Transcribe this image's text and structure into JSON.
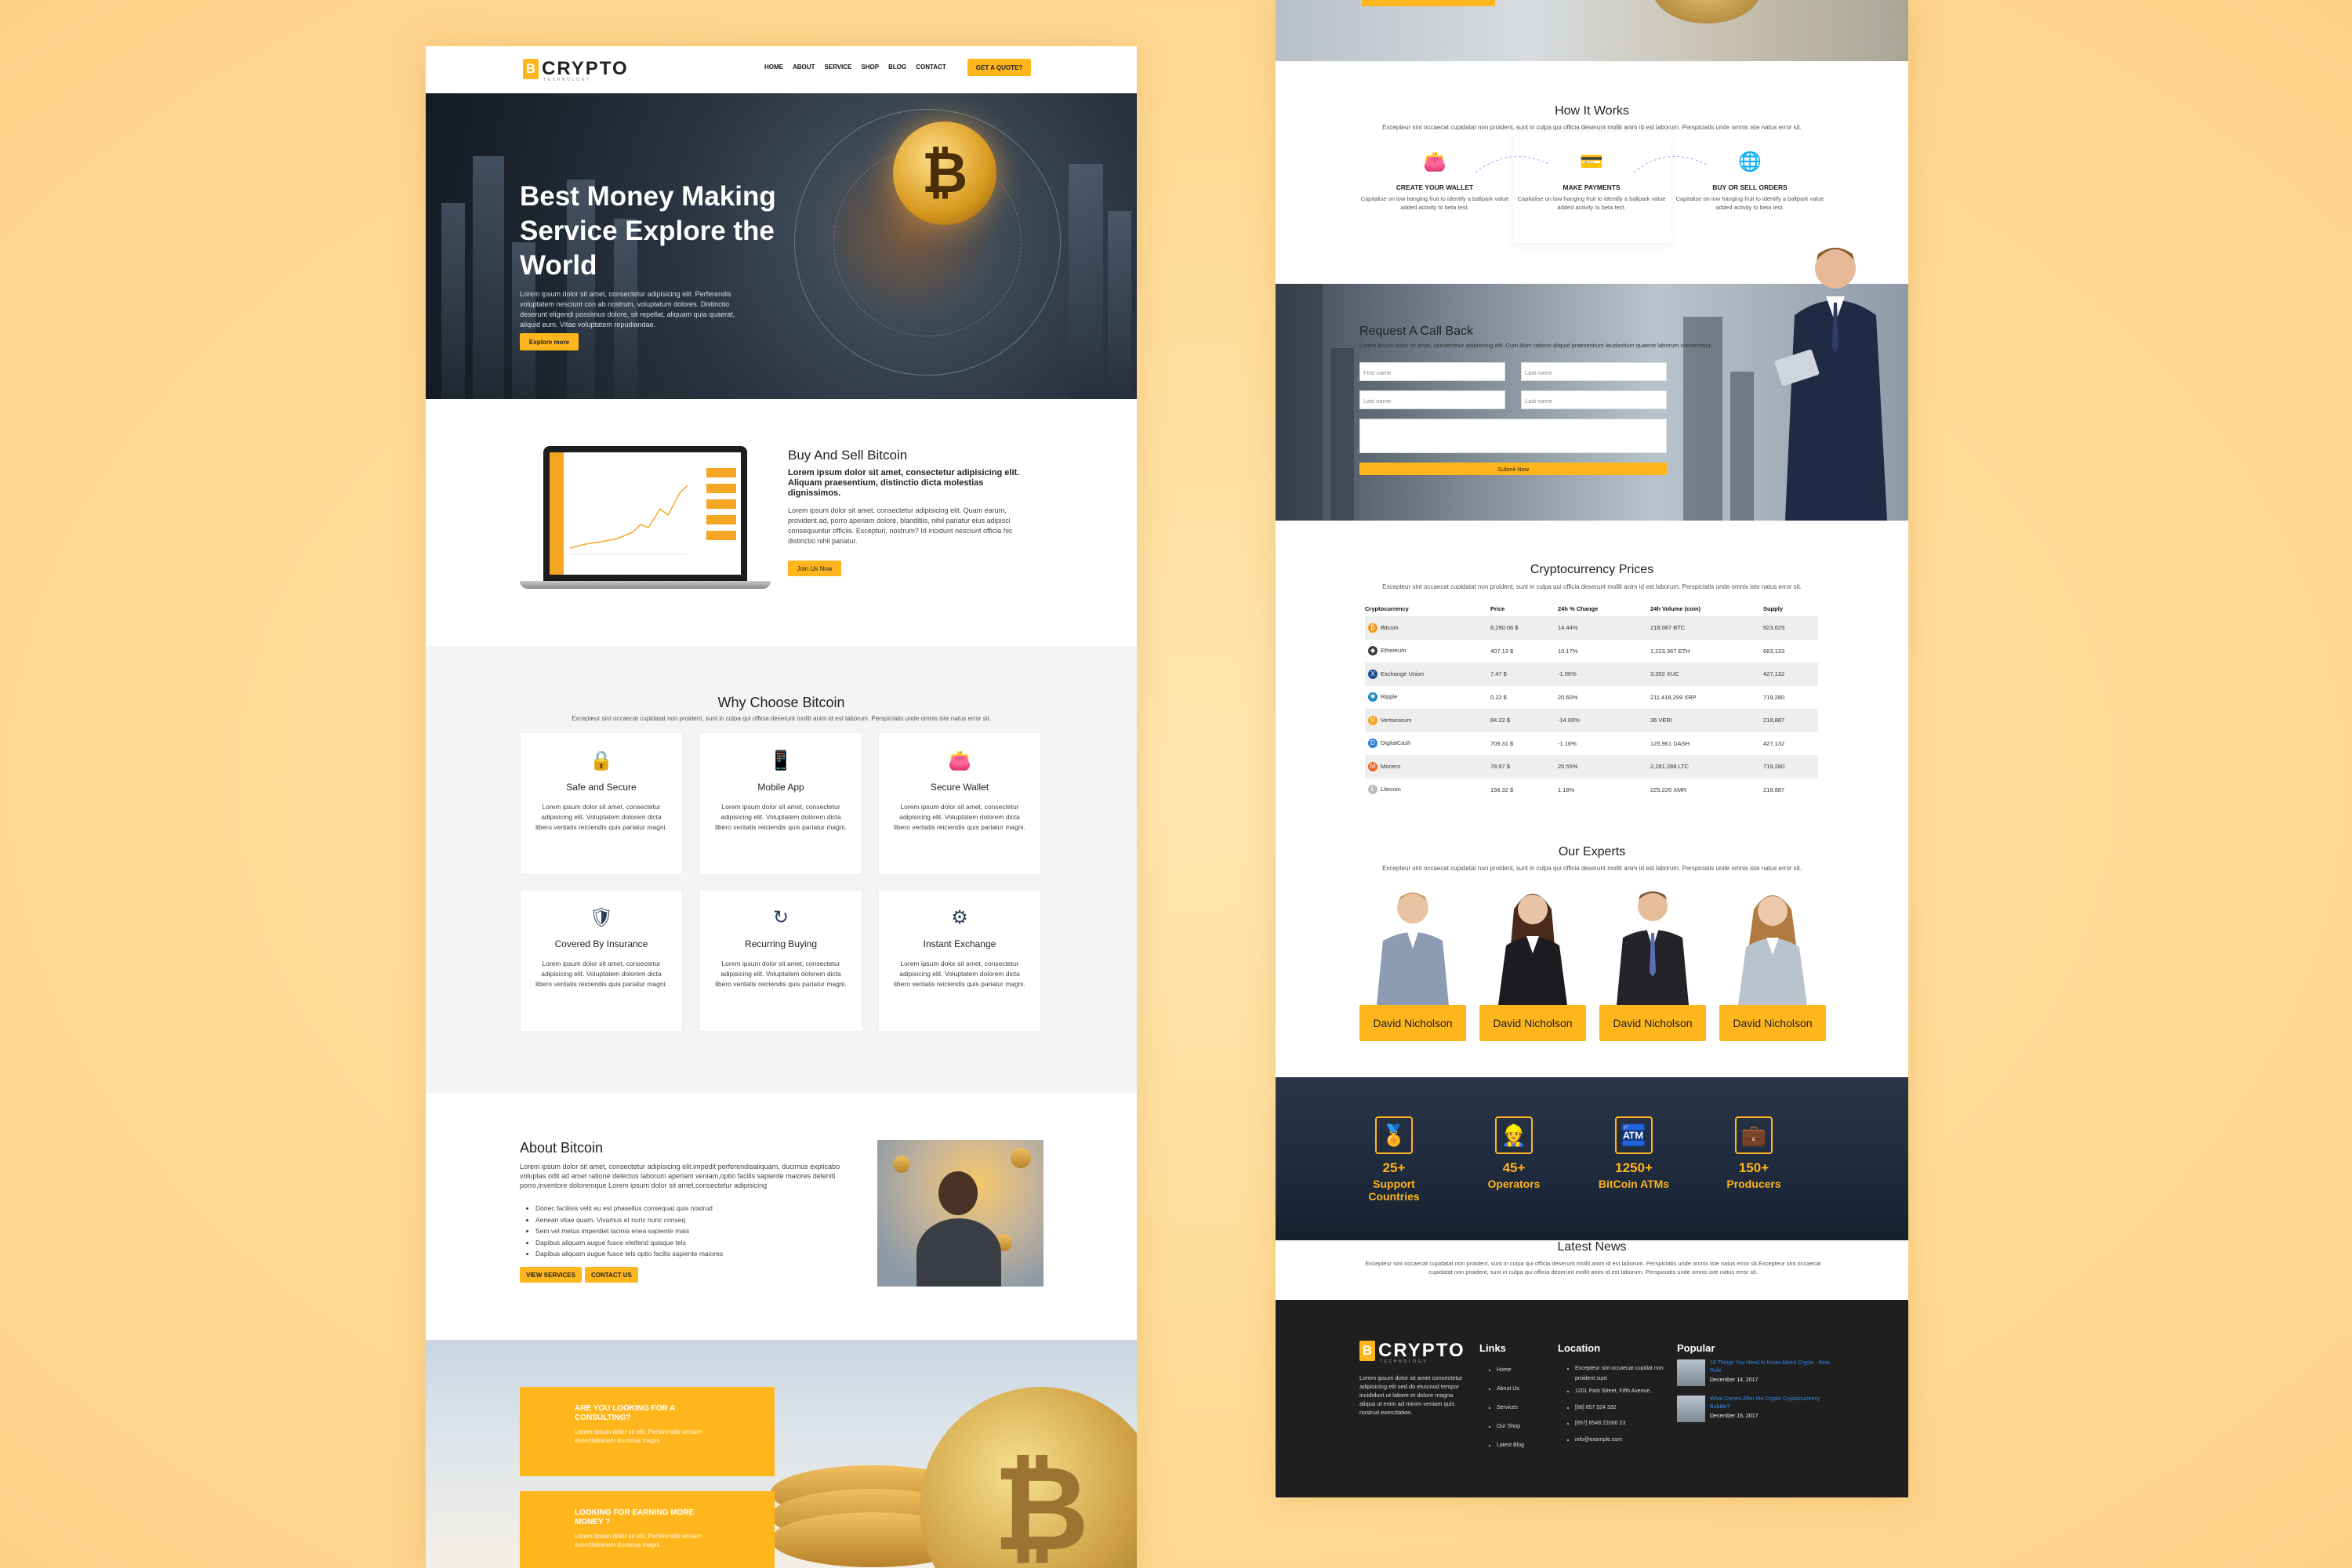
{
  "brand": {
    "logo_letter": "B",
    "name": "CRYPTO",
    "tagline": "TECHNOLOGY",
    "accent": "#ffb61c"
  },
  "left": {
    "nav": {
      "links": [
        "HOME",
        "ABOUT",
        "SERVICE",
        "SHOP",
        "BLOG",
        "CONTACT"
      ],
      "cta": "GET A QUOTE?"
    },
    "hero": {
      "title": "Best Money Making Service Explore the World",
      "text": "Lorem ipsum dolor sit amet, consectetur adipisicing elit. Perferendis voluptatem nesciunt con ab nostrum, voluptatum dolores. Distinctio deserunt eligendi possimus dolore, sit repellat, aliquam quia quaerat, aliquid eum. Vitae voluptatem repudiandae.",
      "button": "Explore more"
    },
    "buy": {
      "title": "Buy And Sell Bitcoin",
      "lead": "Lorem ipsum dolor sit amet, consectetur adipisicing elit. Aliquam praesentium, distinctio dicta molestias dignissimos.",
      "text": "Lorem ipsum dolor sit amet, consectetur adipisicing elit. Quam earum, provident ad, porro aperiam dolore, blanditiis, nihil pariatur eius adipisci consequuntur officiis. Excepturi, nostrum? Id incidunt nesciunt officia hic distinctio nihil pariatur.",
      "button": "Join Us Now"
    },
    "why": {
      "title": "Why Choose Bitcoin",
      "subtitle": "Excepteur sint occaecat cupidatat non proident, sunt in culpa qui officia deserunt mollit anim id est laborum. Perspiciatis unde omnis iste natus error sit.",
      "cards": [
        {
          "title": "Safe and Secure",
          "icon": "lock-bitcoin-icon",
          "text": "Lorem ipsum dolor sit amet, consectetur adipisicing elit. Voluptatem dolorem dicta libero veritatis reiciendis quis pariatur magni."
        },
        {
          "title": "Mobile App",
          "icon": "mobile-bitcoin-icon",
          "text": "Lorem ipsum dolor sit amet, consectetur adipisicing elit. Voluptatem dolorem dicta libero veritatis reiciendis quis pariatur magni."
        },
        {
          "title": "Secure Wallet",
          "icon": "wallet-icon",
          "text": "Lorem ipsum dolor sit amet, consectetur adipisicing elit. Voluptatem dolorem dicta libero veritatis reiciendis quis pariatur magni."
        },
        {
          "title": "Covered By Insurance",
          "icon": "shield-bitcoin-icon",
          "text": "Lorem ipsum dolor sit amet, consectetur adipisicing elit. Voluptatem dolorem dicta libero veritatis reiciendis quis pariatur magni."
        },
        {
          "title": "Recurring Buying",
          "icon": "recurring-bitcoin-icon",
          "text": "Lorem ipsum dolor sit amet, consectetur adipisicing elit. Voluptatem dolorem dicta libero veritatis reiciendis quis pariatur magni."
        },
        {
          "title": "Instant Exchange",
          "icon": "gear-bitcoin-icon",
          "text": "Lorem ipsum dolor sit amet, consectetur adipisicing elit. Voluptatem dolorem dicta libero veritatis reiciendis quis pariatur magni."
        }
      ]
    },
    "about": {
      "title": "About Bitcoin",
      "text": "Lorem ipsum dolor sit amet, consectetur adipisicing elit.impedit perferendisaliquam, ducimus explicabo voluptas odit ad amet ratione delectus laborum aperiam veniam,optio facilis sapiente maiores deleniti porro,inventore doloremque Lorem ipsum dolor sit amet,consectetur adipisicing",
      "list": [
        "Donec facilisis velit eu est phasellus consequat quis nostrud",
        "Aenean vitae quam. Vivamus et nunc nunc conseq",
        "Sem vel metus imperdiet lacinia enea sapiente mais",
        "Dapibus aliquam augue fusce eleifend quisque tels",
        "Dapibus aliquam augue fusce tels optio facilis sapiente maiores"
      ],
      "buttons": [
        "VIEW SERVICES",
        "CONTACT US"
      ]
    },
    "consult": [
      {
        "title": "ARE YOU LOOKING FOR A CONSULTING?",
        "text": "Lorem ipsum dolor sit elit. Perferendis veniam exercitationem ducimus magni."
      },
      {
        "title": "LOOKING FOR EARNING MORE MONEY ?",
        "text": "Lorem ipsum dolor sit elit. Perferendis veniam exercitationem ducimus magni."
      }
    ]
  },
  "right": {
    "how": {
      "title": "How It Works",
      "subtitle": "Excepteur sint occaecat cupidatat non proident, sunt in culpa qui officia deserunt mollit anim id est laborum. Perspiciatis unde omnis iste natus error sit.",
      "steps": [
        {
          "title": "CREATE YOUR WALLET",
          "icon": "wallet-icon",
          "text": "Capitalise on low hanging fruit to identify a ballpark value added activity to beta test."
        },
        {
          "title": "MAKE PAYMENTS",
          "icon": "payment-icon",
          "text": "Capitalise on low hanging fruit to identify a ballpark value added activity to beta test."
        },
        {
          "title": "BUY OR SELL ORDERS",
          "icon": "globe-bitcoin-icon",
          "text": "Capitalise on low hanging fruit to identify a ballpark value added activity to beta test."
        }
      ]
    },
    "callback": {
      "title": "Request A Call Back",
      "subtitle": "Lorem ipsum dolor sit amet, consectetur adipisicing elit. Cum illum ratione aliquid praesentium laudantium quaerat laborum consectetur",
      "placeholders": [
        "First name",
        "Last name",
        "Last name",
        "Last name"
      ],
      "submit": "Submit Now"
    },
    "prices": {
      "title": "Cryptocurrency Prices",
      "subtitle": "Excepteur sint occaecat cupidatat non proident, sunt in culpa qui officia deserunt mollit anim id est laborum. Perspiciatis unde omnis iste natus error sit.",
      "headers": [
        "Cryptocurrency",
        "Price",
        "24h % Change",
        "24h Volume (coin)",
        "Supply"
      ],
      "rows": [
        {
          "name": "Bitcoin",
          "color": "#f7931a",
          "glyph": "₿",
          "price": "6,290.06 $",
          "change": "14.44%",
          "dir": "pos",
          "volume": "218,087 BTC",
          "supply": "923,629"
        },
        {
          "name": "Ethereum",
          "color": "#3c3c3d",
          "glyph": "◆",
          "price": "407.13 $",
          "change": "10.17%",
          "dir": "pos",
          "volume": "1,223,367 ETH",
          "supply": "663,133"
        },
        {
          "name": "Exchange Union",
          "color": "#1d4e8f",
          "glyph": "X",
          "price": "7.47 $",
          "change": "-1.06%",
          "dir": "neg",
          "volume": "3,352 XUC",
          "supply": "427,132"
        },
        {
          "name": "Ripple",
          "color": "#1f86c8",
          "glyph": "✱",
          "price": "0.22 $",
          "change": "20.60%",
          "dir": "pos",
          "volume": "211,418,299 XRP",
          "supply": "719,280"
        },
        {
          "name": "Vertseseum",
          "color": "#f5a623",
          "glyph": "V",
          "price": "84.22 $",
          "change": "-14.06%",
          "dir": "neg",
          "volume": "36 VERI",
          "supply": "218,887"
        },
        {
          "name": "DigitalCash",
          "color": "#2f7ed8",
          "glyph": "D",
          "price": "709.31 $",
          "change": "-1.16%",
          "dir": "neg",
          "volume": "125,961 DASH",
          "supply": "427,132"
        },
        {
          "name": "Monero",
          "color": "#f26822",
          "glyph": "M",
          "price": "78.97 $",
          "change": "20.55%",
          "dir": "pos",
          "volume": "2,281,288 LTC",
          "supply": "719,280"
        },
        {
          "name": "Litecoin",
          "color": "#bfbbbb",
          "glyph": "Ł",
          "price": "156.32 $",
          "change": "1.18%",
          "dir": "pos",
          "volume": "225,226 XMR",
          "supply": "218,887"
        }
      ]
    },
    "experts": {
      "title": "Our Experts",
      "subtitle": "Excepteur sint occaecat cupidatat non proident, sunt in culpa qui officia deserunt mollit anim id est laborum. Perspiciatis unde omnis iste natus error sit.",
      "names": [
        "David Nicholson",
        "David Nicholson",
        "David Nicholson",
        "David Nicholson"
      ]
    },
    "stats": [
      {
        "num": "25+",
        "label": "Support Countries",
        "icon": "award-icon"
      },
      {
        "num": "45+",
        "label": "Operators",
        "icon": "operator-icon"
      },
      {
        "num": "1250+",
        "label": "BitCoin ATMs",
        "icon": "atm-icon"
      },
      {
        "num": "150+",
        "label": "Producers",
        "icon": "producer-icon"
      }
    ],
    "news": {
      "title": "Latest News",
      "subtitle": "Excepteur sint occaecat cupidatat non proident, sunt in culpa qui officia deserunt mollit anim id est laborum. Perspiciatis unde omnis iste natus error sit.Excepteur sint occaecat cupidatat non proident, sunt in culpa qui officia deserunt mollit anim id est laborum. Perspiciatis unde omnis iste natus error sit."
    },
    "footer": {
      "about": "Lorem ipsum dolor sit amet consectetur adipisicing elit sed do eiusmod tempor incididunt ut labore et dolore magna aliqua ut enim ad minim veniam quis nostrud exercitation.",
      "links_title": "Links",
      "links": [
        "Home",
        "About Us",
        "Services",
        "Our Shop",
        "Latest Blog"
      ],
      "location_title": "Location",
      "location": [
        "Excepteur sint occaecat cupidat non proident sunt",
        "1201 Park Street, Fifth Avenue,",
        "[88] 657 524 332",
        "[657] 6548 22000 23",
        "info@example.com"
      ],
      "popular_title": "Popular",
      "posts": [
        {
          "title": "10 Things You Need to Know About Crypto - New Rule",
          "date": "December 14, 2017"
        },
        {
          "title": "What Comes After the Crypto Cryptocurrency Bubble?",
          "date": "December 15, 2017"
        }
      ]
    }
  }
}
